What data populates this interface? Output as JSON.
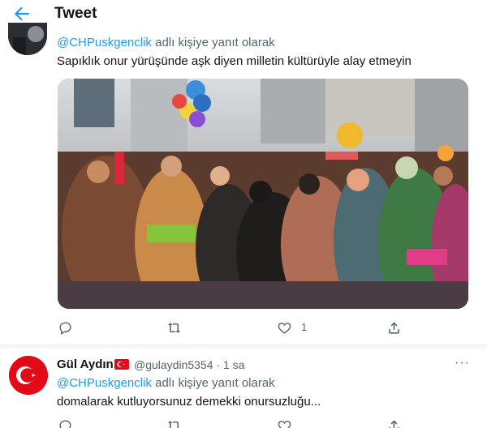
{
  "header": {
    "title": "Tweet",
    "back_icon": "arrow-left-icon"
  },
  "colors": {
    "accent": "#1d9bf0",
    "text": "#0f1419",
    "secondary": "#536471",
    "flag_red": "#e30a17"
  },
  "tweet1": {
    "reply_mention": "@CHPuskgenclik",
    "reply_suffix": " adlı kişiye yanıt olarak",
    "text": "Sapıklık onur yürüşünde  aşk diyen milletin kültürüyle alay etmeyin",
    "media_icon": "photo-pride-parade-crowd",
    "actions": {
      "reply_icon": "reply-icon",
      "retweet_icon": "retweet-icon",
      "like_icon": "heart-icon",
      "like_count": "1",
      "share_icon": "share-icon"
    }
  },
  "tweet2": {
    "name": "Gül Aydın",
    "flag_icon": "turkey-flag-icon",
    "handle_time": "@gulaydin5354 · 1 sa",
    "more_icon": "more-icon",
    "reply_mention": "@CHPuskgenclik",
    "reply_suffix": " adlı kişiye yanıt olarak",
    "text": "domalarak kutluyorsunuz demekki onursuzluğu..."
  }
}
